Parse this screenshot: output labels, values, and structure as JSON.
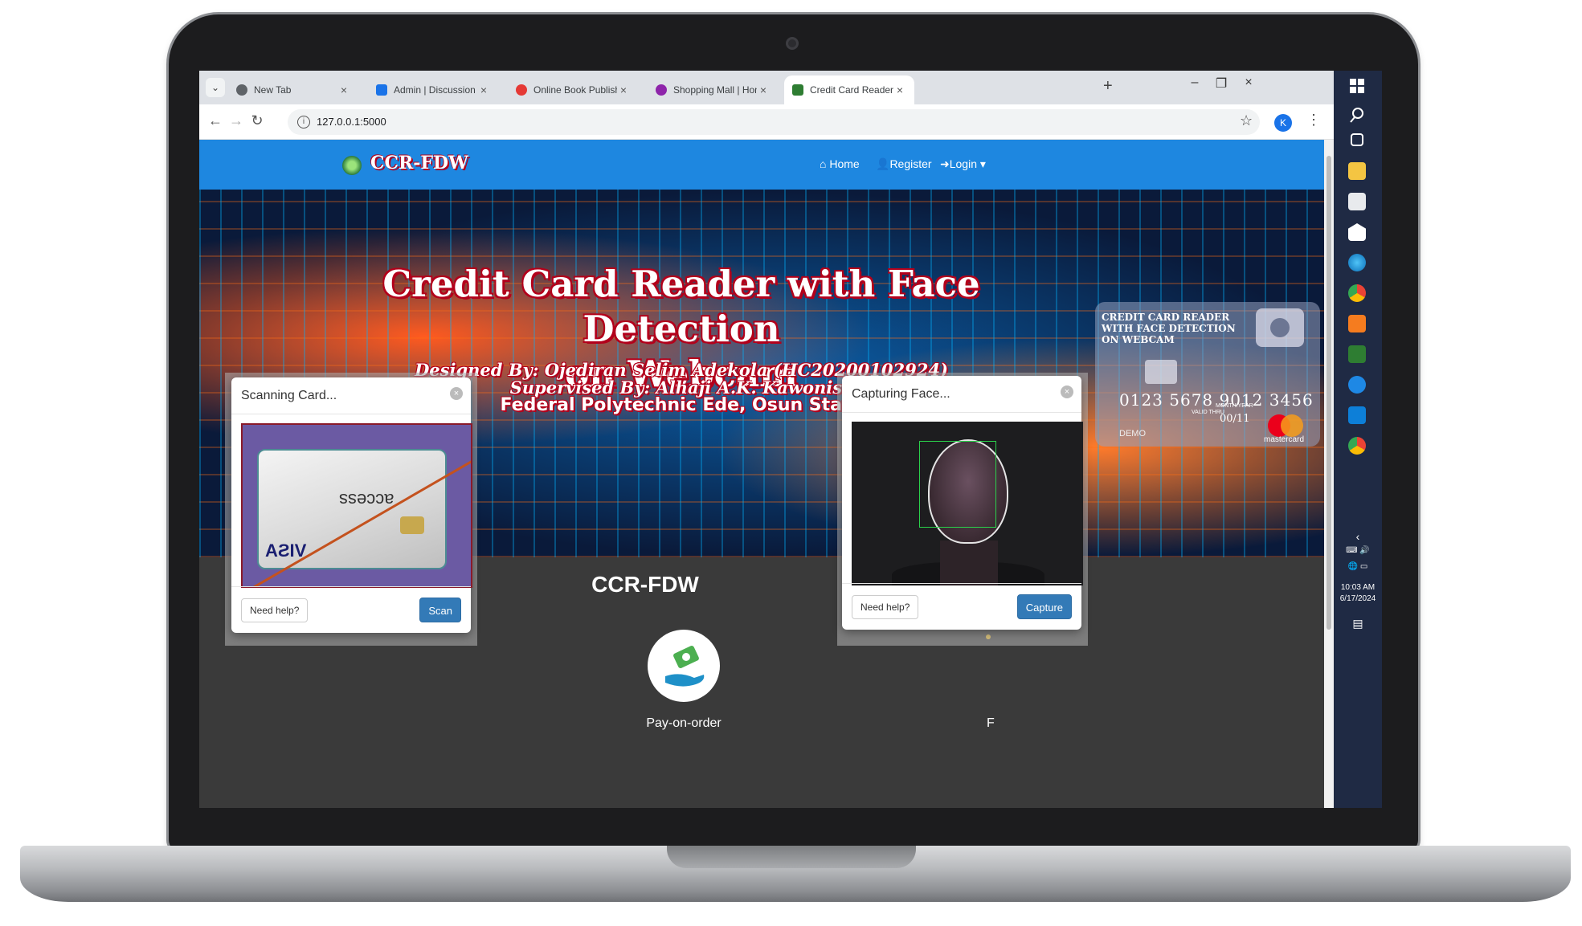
{
  "browser": {
    "tabs": [
      {
        "label": "New Tab",
        "favicon_color": "#5f6368",
        "active": false
      },
      {
        "label": "Admin | Discussion",
        "favicon_color": "#1a73e8",
        "active": false
      },
      {
        "label": "Online Book Publishing | Index",
        "favicon_color": "#e53935",
        "active": false
      },
      {
        "label": "Shopping Mall | Home Page",
        "favicon_color": "#8e24aa",
        "active": false
      },
      {
        "label": "Credit Card Reader with Face D",
        "favicon_color": "#2e7d32",
        "active": true
      }
    ],
    "new_tab": "+",
    "tab_close": "×",
    "window_controls": {
      "minimize": "–",
      "restore": "❐",
      "close": "×"
    },
    "url": "127.0.0.1:5000",
    "profile_initial": "K",
    "nav": {
      "back": "←",
      "forward": "→",
      "reload": "↻",
      "star": "☆",
      "menu": "⋮",
      "tab_search": "⌄",
      "site_info": "i"
    }
  },
  "site": {
    "brand": "CCR-FDW",
    "nav": {
      "home": "⌂ Home",
      "register": "Register",
      "login": "Login ▾"
    },
    "hero": {
      "title_line1": "Credit Card Reader with Face Detection",
      "title_line2": "on Webcam",
      "designed_by": "Designed By: Ojediran Selim Adekola (HC20200102924)",
      "supervised_by": "Supervised By: Alhaji A.K. Kawonise",
      "institution": "Federal Polytechnic Ede, Osun State"
    },
    "hero_card": {
      "title": "CREDIT CARD READER WITH FACE DETECTION ON WEBCAM",
      "number": "0123 5678 9012 3456",
      "valid_label": "VALID THRU",
      "month_year_label": "MONTH/YEAR",
      "expiry": "00/11",
      "demo": "DEMO",
      "network": "mastercard"
    },
    "section_title": "CCR-FDW",
    "features": [
      {
        "label": "Pay-on-order",
        "icon": "hand-money-icon"
      },
      {
        "label": "F"
      }
    ]
  },
  "modals": {
    "scan": {
      "title": "Scanning Card...",
      "help": "Need help?",
      "action": "Scan",
      "close": "×",
      "card_brand": "access",
      "card_network": "VISA"
    },
    "capture": {
      "title": "Capturing Face...",
      "help": "Need help?",
      "action": "Capture",
      "close": "×"
    }
  },
  "taskbar": {
    "time": "10:03 AM",
    "date": "6/17/2024"
  }
}
